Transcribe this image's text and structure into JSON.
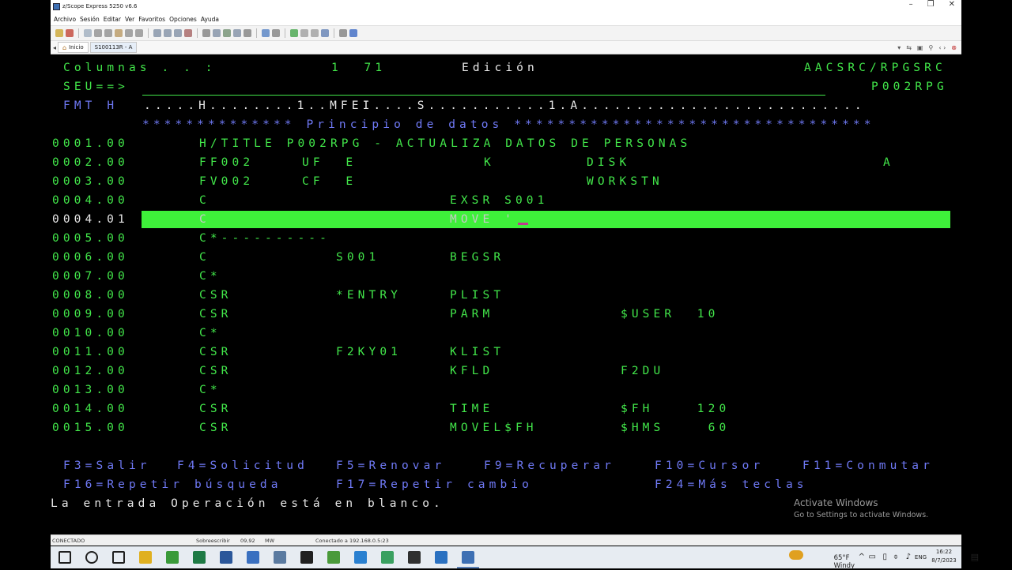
{
  "window": {
    "title": "z/Scope Express 5250 v6.6",
    "controls": [
      "–",
      "❐",
      "✕"
    ]
  },
  "menu": [
    "Archivo",
    "Sesión",
    "Editar",
    "Ver",
    "Favoritos",
    "Opciones",
    "Ayuda"
  ],
  "toolbar": {
    "icons": [
      {
        "name": "connect-icon",
        "color": "#c9a227"
      },
      {
        "name": "disconnect-icon",
        "color": "#c0392b"
      },
      {
        "name": "new-icon",
        "color": "#9aa9bb"
      },
      {
        "name": "cut-icon",
        "color": "#8a8a8a"
      },
      {
        "name": "copy-icon",
        "color": "#8a8a8a"
      },
      {
        "name": "paste-icon",
        "color": "#b5935a"
      },
      {
        "name": "undo-icon",
        "color": "#8a8a8a"
      },
      {
        "name": "delete-icon",
        "color": "#8a8a8a"
      },
      {
        "name": "select-icon",
        "color": "#7a8aa0"
      },
      {
        "name": "copy-screen-icon",
        "color": "#7a8aa0"
      },
      {
        "name": "page-icon",
        "color": "#7a8aa0"
      },
      {
        "name": "print-icon",
        "color": "#a05a5a"
      },
      {
        "name": "settings-icon",
        "color": "#7a7a7a"
      },
      {
        "name": "macro-icon",
        "color": "#7a8aa0"
      },
      {
        "name": "record-icon",
        "color": "#6a8a6a"
      },
      {
        "name": "transfer-icon",
        "color": "#7a8aa0"
      },
      {
        "name": "keyboard-icon",
        "color": "#7a7a7a"
      },
      {
        "name": "layout-icon",
        "color": "#4a7ac0"
      },
      {
        "name": "capture-icon",
        "color": "#7a7a7a"
      },
      {
        "name": "go-icon",
        "color": "#3aa040"
      },
      {
        "name": "stop-icon",
        "color": "#9a9a9a"
      },
      {
        "name": "refresh-icon",
        "color": "#9a9a9a"
      },
      {
        "name": "screen-icon",
        "color": "#5a7ab0"
      },
      {
        "name": "window-icon",
        "color": "#7a7a7a"
      },
      {
        "name": "help-icon",
        "color": "#3060c0"
      }
    ]
  },
  "tabs": [
    {
      "label": "Inicio",
      "icon": "home-icon"
    },
    {
      "label": "S100113R - A",
      "icon": ""
    }
  ],
  "screen": {
    "header": [
      {
        "text": "Columnas . . :",
        "col": 16,
        "color": "green"
      },
      {
        "text": "1  71",
        "col": 355,
        "color": "green"
      },
      {
        "text": "Edición",
        "col": 520,
        "color": "white"
      },
      {
        "text": "AACSRC/RPGSRC",
        "col": 953,
        "color": "green"
      }
    ],
    "row2": [
      {
        "text": "SEU==>",
        "col": 16,
        "color": "green"
      },
      {
        "text": "P002RPG",
        "col": 1038,
        "color": "green"
      }
    ],
    "row3": [
      {
        "text": "FMT H",
        "col": 16,
        "color": "blue"
      },
      {
        "text": ".....H........1..MFEI....S...........1.A..........................",
        "col": 118,
        "color": "white"
      }
    ],
    "banner": "************** Principio de datos *********************************",
    "lines": [
      {
        "seq": "0001.00",
        "fields": [
          {
            "text": "H/TITLE P002RPG - ACTUALIZA DATOS DE PERSONAS",
            "col": 188
          }
        ]
      },
      {
        "seq": "0002.00",
        "fields": [
          {
            "text": "FF002",
            "col": 188
          },
          {
            "text": "UF  E",
            "col": 318
          },
          {
            "text": "K",
            "col": 548
          },
          {
            "text": "DISK",
            "col": 678
          },
          {
            "text": "A",
            "col": 1053
          }
        ]
      },
      {
        "seq": "0003.00",
        "fields": [
          {
            "text": "FV002",
            "col": 188
          },
          {
            "text": "CF  E",
            "col": 318
          },
          {
            "text": "WORKSTN",
            "col": 678
          }
        ]
      },
      {
        "seq": "0004.00",
        "fields": [
          {
            "text": "C",
            "col": 188
          },
          {
            "text": "EXSR S001",
            "col": 505
          }
        ]
      },
      {
        "seq": "0004.01",
        "fields": [
          {
            "text": "C",
            "col": 188
          },
          {
            "text": "MOVE '",
            "col": 505
          }
        ],
        "highlight": true
      },
      {
        "seq": "0005.00",
        "fields": [
          {
            "text": "C*----------",
            "col": 188
          }
        ]
      },
      {
        "seq": "0006.00",
        "fields": [
          {
            "text": "C",
            "col": 188
          },
          {
            "text": "S001",
            "col": 361
          },
          {
            "text": "BEGSR",
            "col": 505
          }
        ]
      },
      {
        "seq": "0007.00",
        "fields": [
          {
            "text": "C*",
            "col": 188
          }
        ]
      },
      {
        "seq": "0008.00",
        "fields": [
          {
            "text": "CSR",
            "col": 188
          },
          {
            "text": "*ENTRY",
            "col": 361
          },
          {
            "text": "PLIST",
            "col": 505
          }
        ]
      },
      {
        "seq": "0009.00",
        "fields": [
          {
            "text": "CSR",
            "col": 188
          },
          {
            "text": "PARM",
            "col": 505
          },
          {
            "text": "$USER  10",
            "col": 721
          }
        ]
      },
      {
        "seq": "0010.00",
        "fields": [
          {
            "text": "C*",
            "col": 188
          }
        ]
      },
      {
        "seq": "0011.00",
        "fields": [
          {
            "text": "CSR",
            "col": 188
          },
          {
            "text": "F2KY01",
            "col": 361
          },
          {
            "text": "KLIST",
            "col": 505
          }
        ]
      },
      {
        "seq": "0012.00",
        "fields": [
          {
            "text": "CSR",
            "col": 188
          },
          {
            "text": "KFLD",
            "col": 505
          },
          {
            "text": "F2DU",
            "col": 721
          }
        ]
      },
      {
        "seq": "0013.00",
        "fields": [
          {
            "text": "C*",
            "col": 188
          }
        ]
      },
      {
        "seq": "0014.00",
        "fields": [
          {
            "text": "CSR",
            "col": 188
          },
          {
            "text": "TIME",
            "col": 505
          },
          {
            "text": "$FH    120",
            "col": 721
          }
        ]
      },
      {
        "seq": "0015.00",
        "fields": [
          {
            "text": "CSR",
            "col": 188
          },
          {
            "text": "MOVEL$FH",
            "col": 505
          },
          {
            "text": "$HMS    60",
            "col": 721
          }
        ]
      }
    ],
    "fkeys_row1": [
      {
        "text": "F3=Salir",
        "col": 16
      },
      {
        "text": "F4=Solicitud",
        "col": 160
      },
      {
        "text": "F5=Renovar",
        "col": 361
      },
      {
        "text": "F9=Recuperar",
        "col": 548
      },
      {
        "text": "F10=Cursor",
        "col": 764
      },
      {
        "text": "F11=Conmutar",
        "col": 951
      }
    ],
    "fkeys_row2": [
      {
        "text": "F16=Repetir búsqueda",
        "col": 16
      },
      {
        "text": "F17=Repetir cambio",
        "col": 361
      },
      {
        "text": "F24=Más teclas",
        "col": 764
      }
    ],
    "message": "La entrada Operación está en blanco."
  },
  "watermark": {
    "line1": "Activate Windows",
    "line2": "Go to Settings to activate Windows."
  },
  "statusbar": {
    "state": "CONECTADO",
    "mode": "Sobreescribir",
    "position": "09,92",
    "mw": "MW",
    "connection": "Conectado a 192.168.0.5:23"
  },
  "taskbar": {
    "apps": [
      {
        "name": "start-icon",
        "color": "#1f1f1f"
      },
      {
        "name": "search-icon",
        "color": "#1f1f1f"
      },
      {
        "name": "task-view-icon",
        "color": "#1f1f1f"
      },
      {
        "name": "file-explorer-icon",
        "color": "#e0b020"
      },
      {
        "name": "chrome-icon",
        "color": "#3a9a3a"
      },
      {
        "name": "excel-icon",
        "color": "#1e7a45"
      },
      {
        "name": "word-icon",
        "color": "#2b579a"
      },
      {
        "name": "app-icon-1",
        "color": "#3a70c0"
      },
      {
        "name": "app-icon-2",
        "color": "#5a7aa0"
      },
      {
        "name": "terminal-icon",
        "color": "#202020"
      },
      {
        "name": "app-icon-3",
        "color": "#4a9a3a"
      },
      {
        "name": "app-icon-4",
        "color": "#2a80d0"
      },
      {
        "name": "app-icon-5",
        "color": "#3aa060"
      },
      {
        "name": "obs-icon",
        "color": "#303030"
      },
      {
        "name": "photos-icon",
        "color": "#2a70c0"
      },
      {
        "name": "zscope-icon",
        "color": "#3d6fb3"
      }
    ],
    "weather": "65°F  Windy",
    "lang": "ENG",
    "time": "16:22",
    "date": "8/7/2023"
  }
}
